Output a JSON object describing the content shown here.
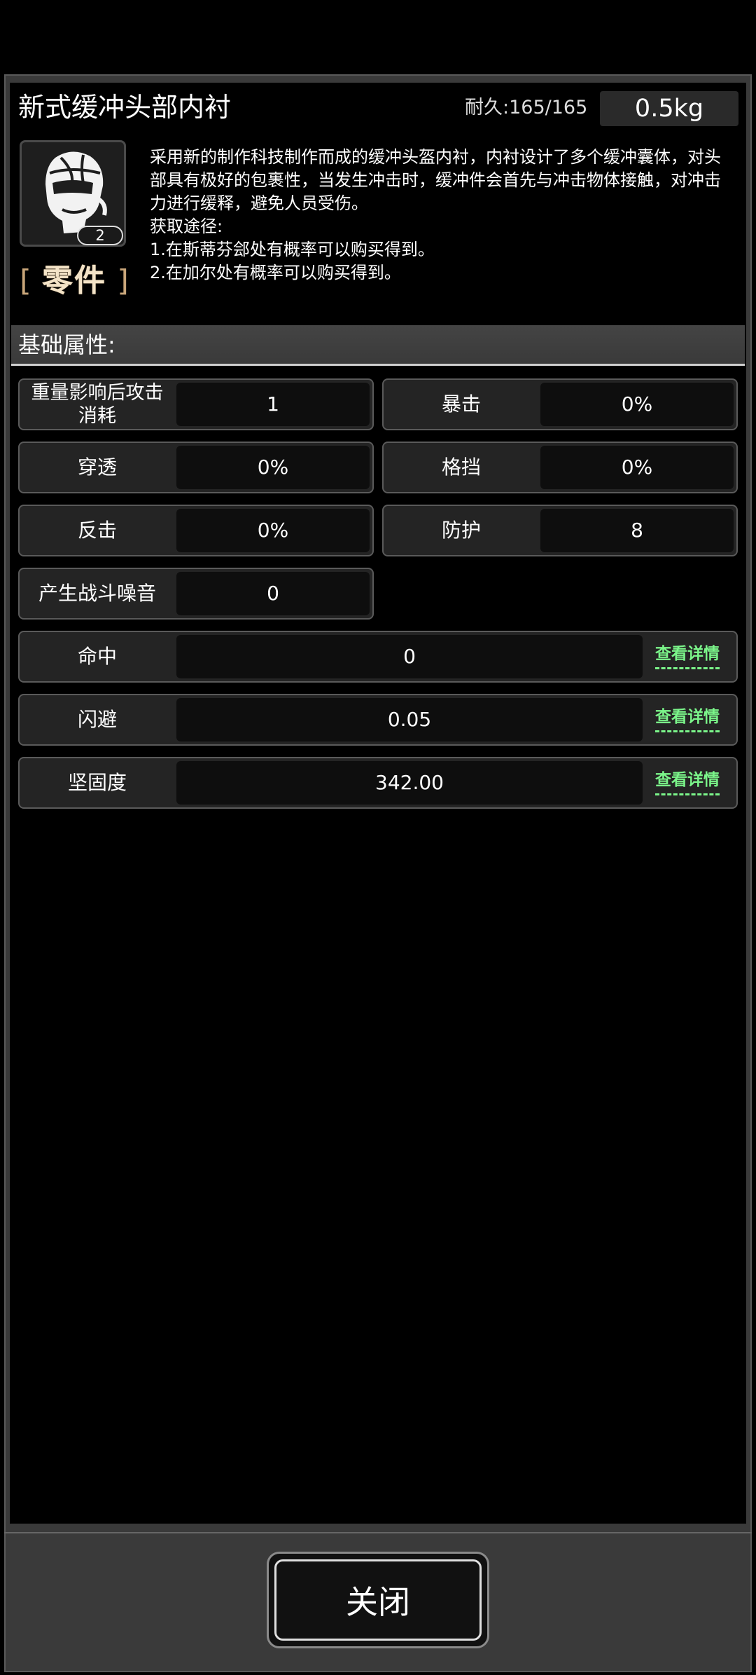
{
  "item": {
    "name": "新式缓冲头部内衬",
    "durability": "耐久:165/165",
    "weight": "0.5kg",
    "count": "2",
    "category_bracket_left": "[",
    "category": "零件",
    "category_bracket_right": "]",
    "description": [
      "采用新的制作科技制作而成的缓冲头盔内衬，内衬设计了多个缓冲囊体，对头部具有极好的包裹性，当发生冲击时，缓冲件会首先与冲击物体接触，对冲击力进行缓释，避免人员受伤。",
      "获取途径:",
      "1.在斯蒂芬郐处有概率可以购买得到。",
      "2.在加尔处有概率可以购买得到。"
    ]
  },
  "section": {
    "title": "基础属性:"
  },
  "attributes": [
    {
      "label": "重量影响后攻击消耗",
      "value": "1"
    },
    {
      "label": "暴击",
      "value": "0%"
    },
    {
      "label": "穿透",
      "value": "0%"
    },
    {
      "label": "格挡",
      "value": "0%"
    },
    {
      "label": "反击",
      "value": "0%"
    },
    {
      "label": "防护",
      "value": "8"
    },
    {
      "label": "产生战斗噪音",
      "value": "0"
    }
  ],
  "detail_attributes": [
    {
      "label": "命中",
      "value": "0",
      "link": "查看详情"
    },
    {
      "label": "闪避",
      "value": "0.05",
      "link": "查看详情"
    },
    {
      "label": "坚固度",
      "value": "342.00",
      "link": "查看详情"
    }
  ],
  "footer": {
    "close_label": "关闭"
  },
  "colors": {
    "link_green": "#7bf58a",
    "category_gold": "#c9a67a"
  },
  "icons": {
    "item_icon": "helmet-liner-icon"
  }
}
